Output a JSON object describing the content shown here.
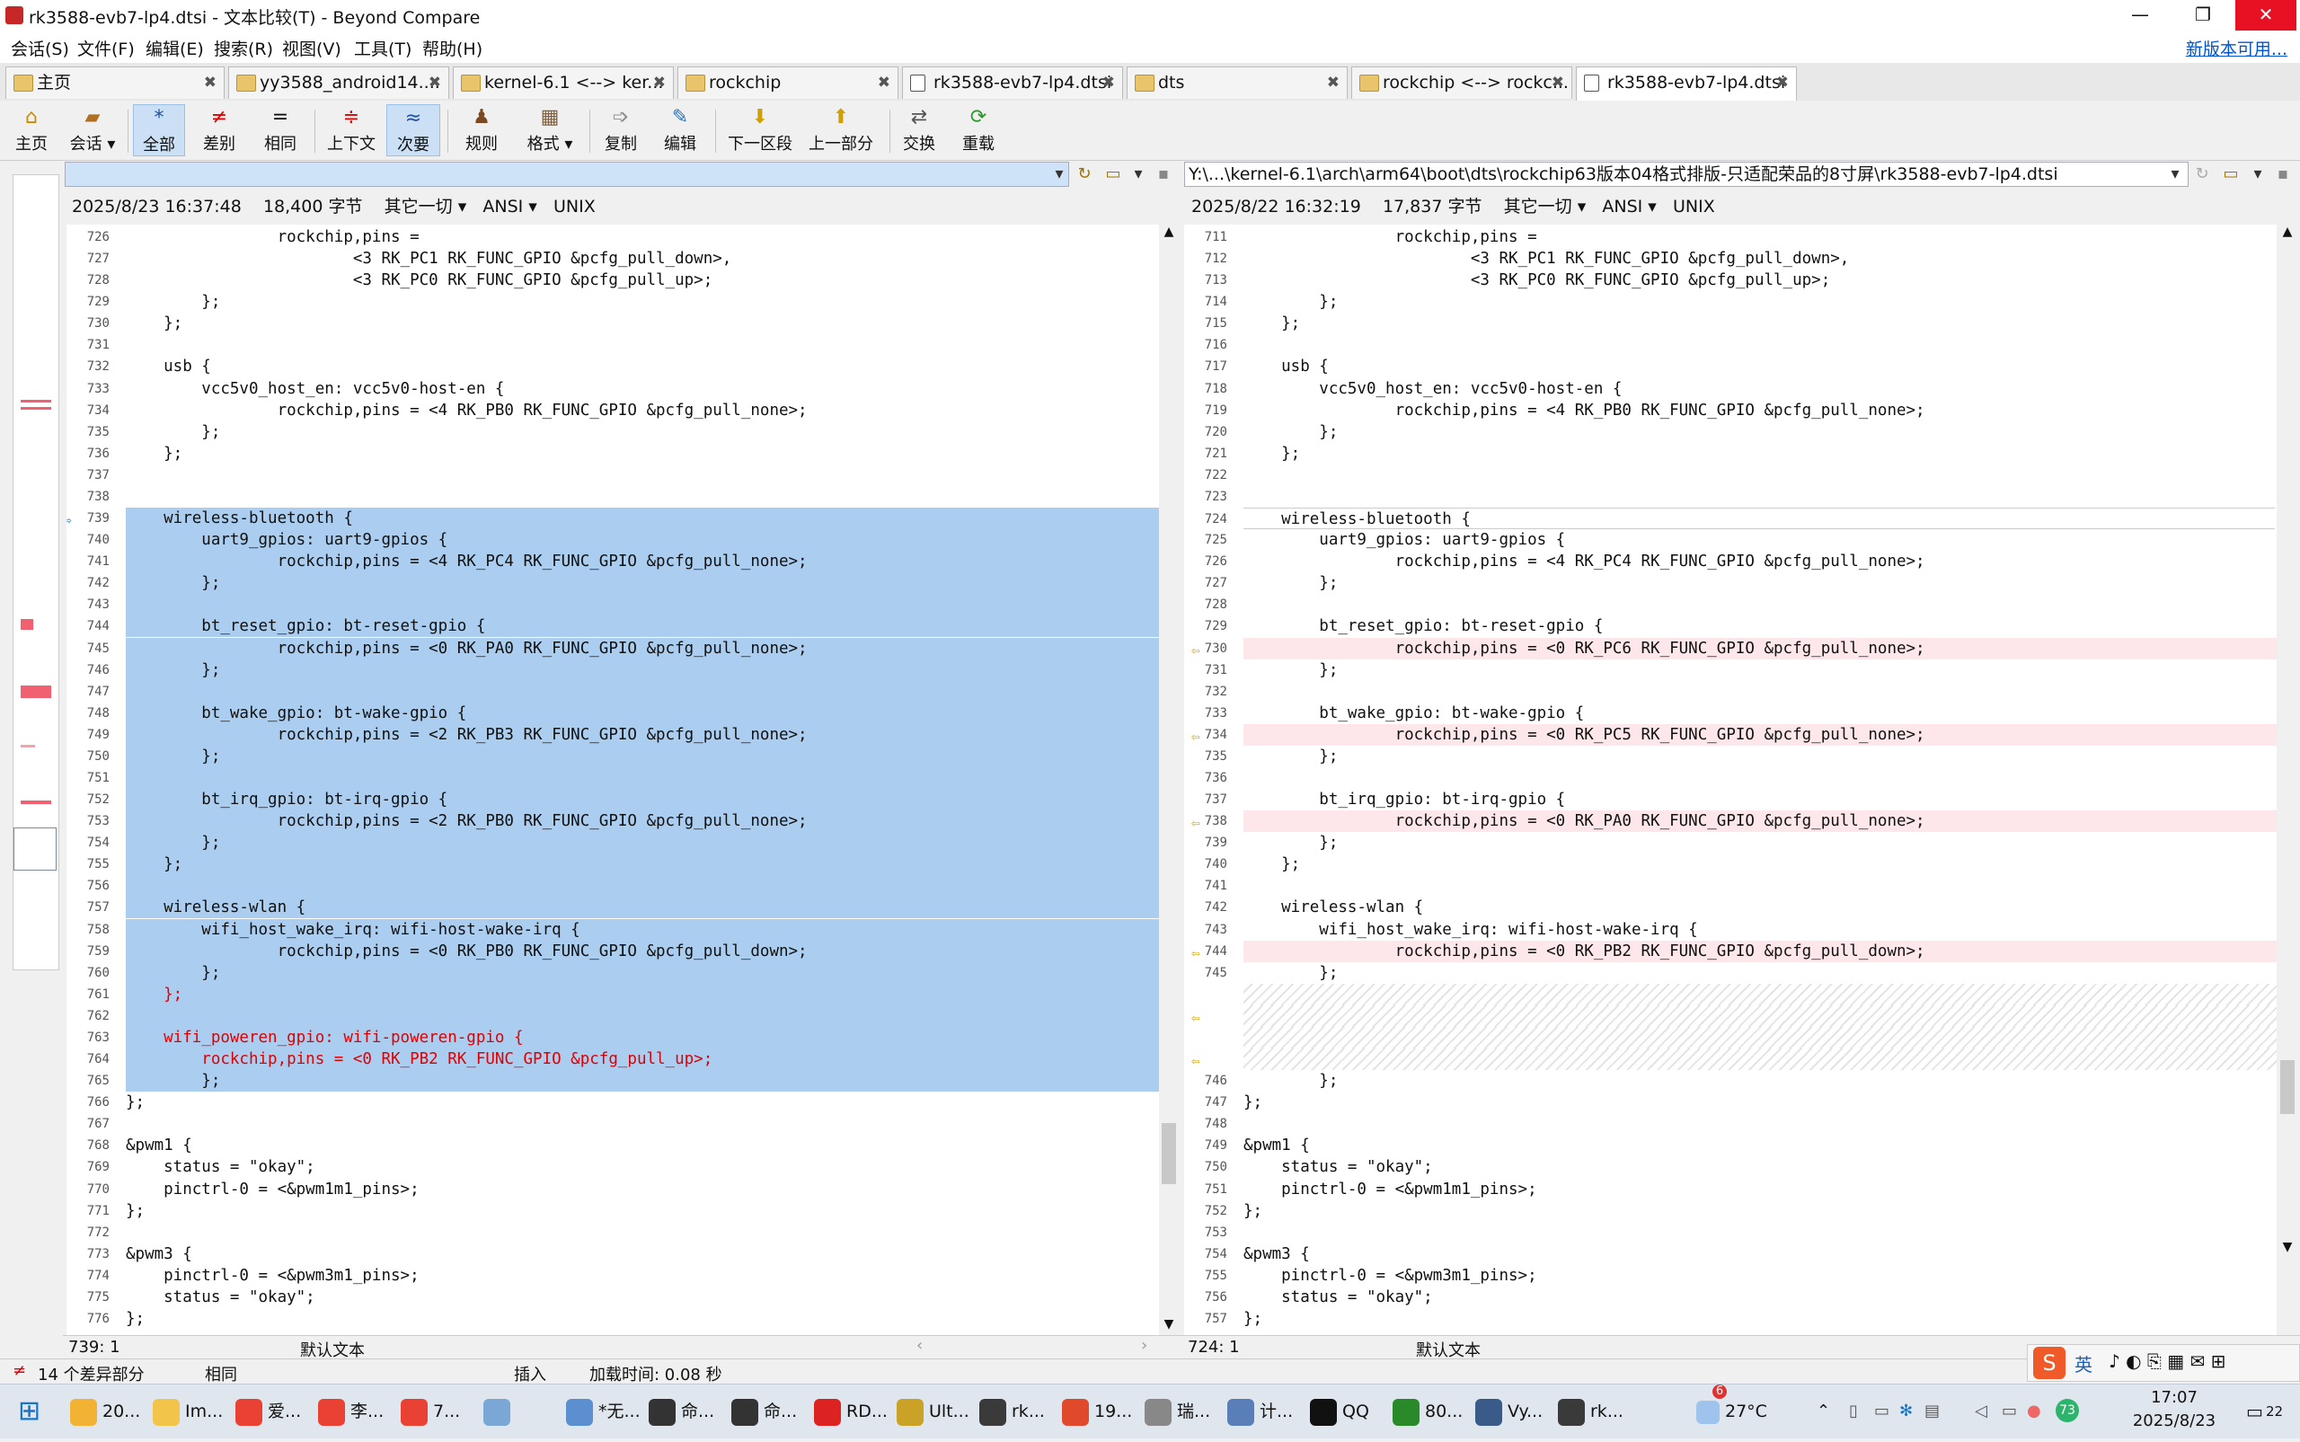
{
  "window": {
    "title": "rk3588-evb7-lp4.dtsi - 文本比较(T) - Beyond Compare",
    "minimize": "—",
    "maximize": "❐",
    "close": "✕"
  },
  "menu": {
    "items": [
      "会话(S)",
      "文件(F)",
      "编辑(E)",
      "搜索(R)",
      "视图(V)",
      "工具(T)",
      "帮助(H)"
    ],
    "new_version": "新版本可用..."
  },
  "tabs": [
    {
      "label": "主页",
      "icon": "home-icon"
    },
    {
      "label": "yy3588_android14....",
      "icon": "folder-icon"
    },
    {
      "label": "kernel-6.1 <--> ker...",
      "icon": "folder-compare-icon"
    },
    {
      "label": "rockchip",
      "icon": "folder-icon"
    },
    {
      "label": "rk3588-evb7-lp4.dtsi",
      "icon": "document-icon"
    },
    {
      "label": "dts",
      "icon": "folder-icon"
    },
    {
      "label": "rockchip <--> rockc...",
      "icon": "folder-compare-icon"
    },
    {
      "label": "rk3588-evb7-lp4.dtsi",
      "icon": "document-icon"
    }
  ],
  "tab_close": "✖",
  "toolbar": {
    "home": "主页",
    "session": "会话",
    "all": "全部",
    "diffs": "差别",
    "same": "相同",
    "context": "上下文",
    "minor": "次要",
    "rules": "规则",
    "format": "格式",
    "copy": "复制",
    "edit": "编辑",
    "next_section": "下一区段",
    "prev_diff": "上一部分",
    "swap": "交换",
    "reload": "重载"
  },
  "left": {
    "path": "",
    "timestamp": "2025/8/23 16:37:48",
    "size": "18,400 字节",
    "filter": "其它一切",
    "encoding": "ANSI",
    "lineend": "UNIX",
    "cursor": "739: 1",
    "syntax": "默认文本"
  },
  "right": {
    "path": "Y:\\...\\kernel-6.1\\arch\\arm64\\boot\\dts\\rockchip63版本04格式排版-只适配荣品的8寸屏\\rk3588-evb7-lp4.dtsi",
    "timestamp": "2025/8/22 16:32:19",
    "size": "17,837 字节",
    "filter": "其它一切",
    "encoding": "ANSI",
    "lineend": "UNIX",
    "cursor": "724: 1",
    "syntax": "默认文本"
  },
  "status": {
    "diff_count": "14 个差异部分",
    "same": "相同",
    "insert": "插入",
    "load_time": "加载时间: 0.08 秒"
  },
  "taskbar": {
    "items": [
      "20...",
      "Im...",
      "爱...",
      "李...",
      "7...",
      "",
      "*无...",
      "命...",
      "命...",
      "RD...",
      "Ult...",
      "rk...",
      "19...",
      "瑞...",
      "计...",
      "QQ",
      "80...",
      "Vy...",
      "rk..."
    ],
    "weather": "27°C",
    "weather_badge": "6",
    "ime": "英",
    "time": "17:07",
    "date": "2025/8/23",
    "notif": "22",
    "badge73": "73"
  }
}
